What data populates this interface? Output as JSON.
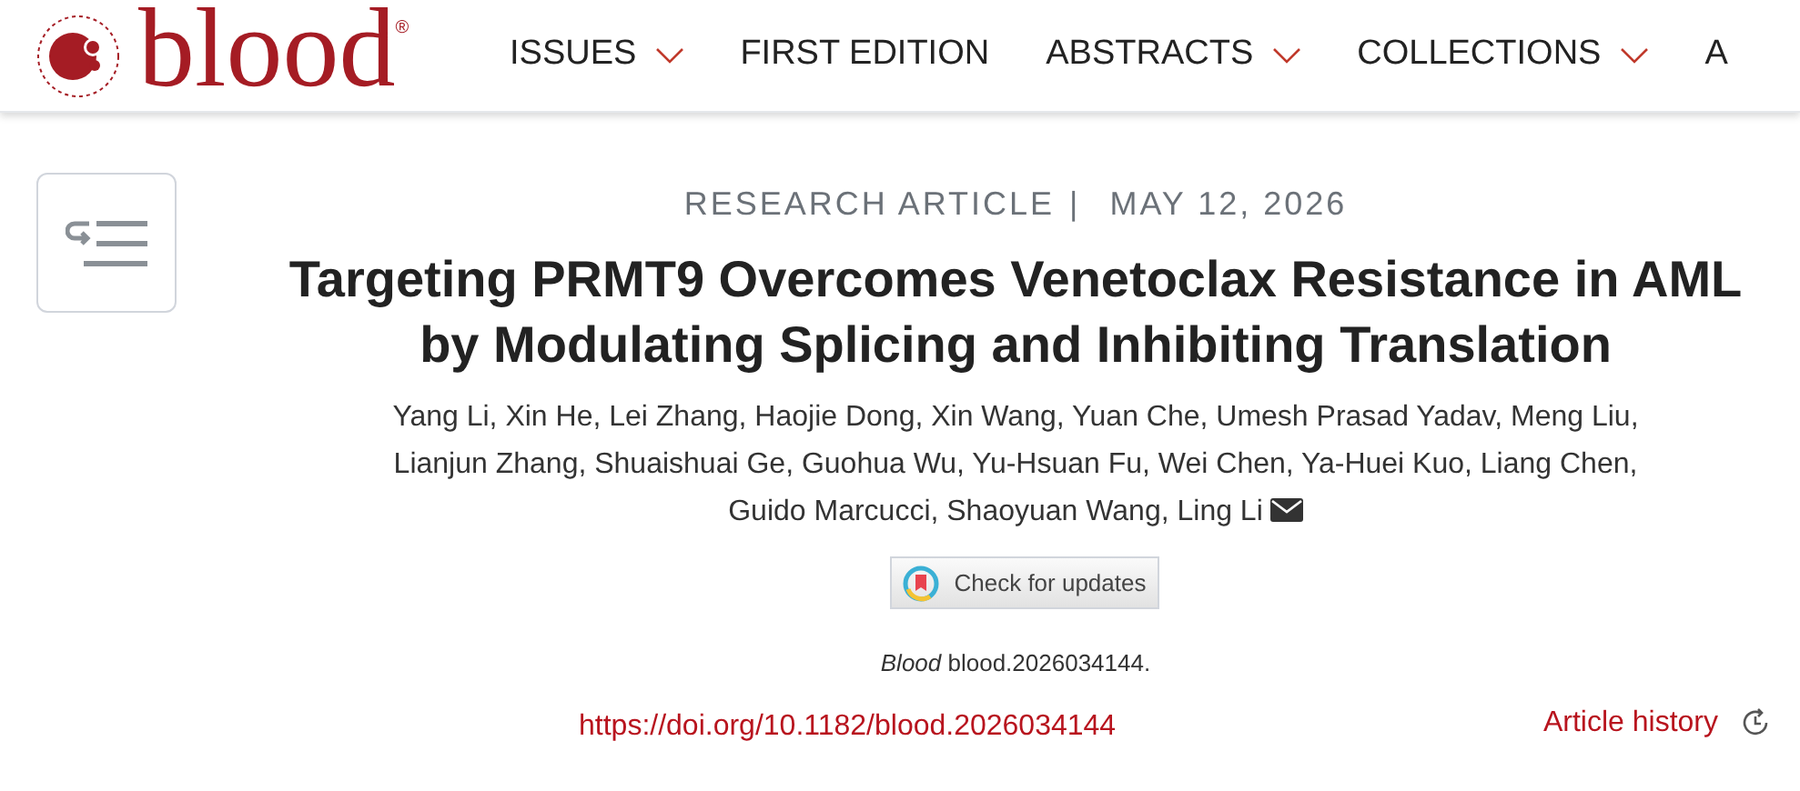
{
  "header": {
    "logo_text": "blood",
    "registered_mark": "®"
  },
  "nav": [
    {
      "label": "ISSUES",
      "has_dropdown": true
    },
    {
      "label": "FIRST EDITION",
      "has_dropdown": false
    },
    {
      "label": "ABSTRACTS",
      "has_dropdown": true
    },
    {
      "label": "COLLECTIONS",
      "has_dropdown": true
    },
    {
      "label": "A",
      "has_dropdown": false
    }
  ],
  "article": {
    "type": "RESEARCH ARTICLE",
    "separator": "|",
    "date": "MAY 12, 2026",
    "title": "Targeting PRMT9 Overcomes Venetoclax Resistance in AML by Modulating Splicing and Inhibiting Translation",
    "authors": "Yang Li, Xin He, Lei Zhang, Haojie Dong, Xin Wang, Yuan Che, Umesh Prasad Yadav, Meng Liu, Lianjun Zhang, Shuaishuai Ge, Guohua Wu, Yu-Hsuan Fu, Wei Chen, Ya-Huei Kuo, Liang Chen, Guido Marcucci, Shaoyuan Wang, Ling Li",
    "updates_button": "Check for updates",
    "citation": "*Blood* blood.2026034144.",
    "doi": "https://doi.org/10.1182/blood.2026034144",
    "history_link": "Article history"
  }
}
